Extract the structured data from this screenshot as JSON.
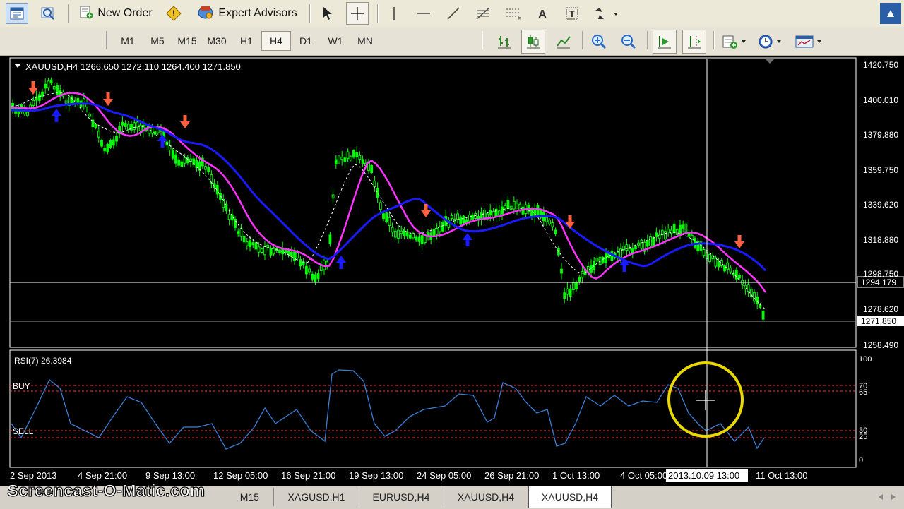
{
  "toolbar": {
    "new_order_label": "New Order",
    "expert_advisors_label": "Expert Advisors",
    "icons": [
      "new-chart-icon",
      "zoom-chart-icon",
      "new-order-icon",
      "warning-icon",
      "expert-advisors-icon",
      "cursor-icon",
      "crosshair-icon",
      "vertical-line-icon",
      "horizontal-line-icon",
      "trendline-icon",
      "fibo-icon",
      "fibo-fan-icon",
      "text-icon",
      "text-label-icon",
      "arrows-icon",
      "dropdown-icon"
    ]
  },
  "timeframes": {
    "items": [
      "M1",
      "M5",
      "M15",
      "M30",
      "H1",
      "H4",
      "D1",
      "W1",
      "MN"
    ],
    "active": "H4"
  },
  "chart": {
    "header": "XAUUSD,H4  1266.650 1272.110 1264.400 1271.850",
    "price_labels": [
      "1420.750",
      "1400.010",
      "1379.880",
      "1359.750",
      "1339.620",
      "1318.880",
      "1298.750",
      "1278.620",
      "1258.490"
    ],
    "marked_prices": {
      "crosshair": "1294.179",
      "current": "1271.850"
    },
    "rsi_header": "RSI(7) 26.3984",
    "rsi_scale": [
      "100",
      "70",
      "65",
      "30",
      "25",
      "0"
    ],
    "rsi_levels": {
      "buy_label": "BUY",
      "sell_label": "SELL"
    },
    "date_labels": [
      "2 Sep 2013",
      "4 Sep 21:00",
      "9 Sep 13:00",
      "12 Sep 05:00",
      "16 Sep 21:00",
      "19 Sep 13:00",
      "24 Sep 05:00",
      "26 Sep 21:00",
      "1 Oct 13:00",
      "4 Oct 05:00",
      "2013.10.09 13:00",
      "11 Oct 13:00"
    ],
    "colors": {
      "candle": "#00ff00",
      "ma_fast": "#ff33ff",
      "ma_slow": "#1a1aff",
      "ma_dashed": "#ffffff",
      "arrow_sell": "#ff6040",
      "arrow_buy": "#1a1aff",
      "rsi_line": "#3a7fd6",
      "level_line": "#ff3030",
      "highlight": "#e8d800"
    }
  },
  "tabs": {
    "items": [
      "M15",
      "XAGUSD,H1",
      "EURUSD,H4",
      "XAUUSD,H4",
      "XAUUSD,H4"
    ],
    "active_index": 4
  },
  "watermark": "Screencast-O-Matic.com"
}
